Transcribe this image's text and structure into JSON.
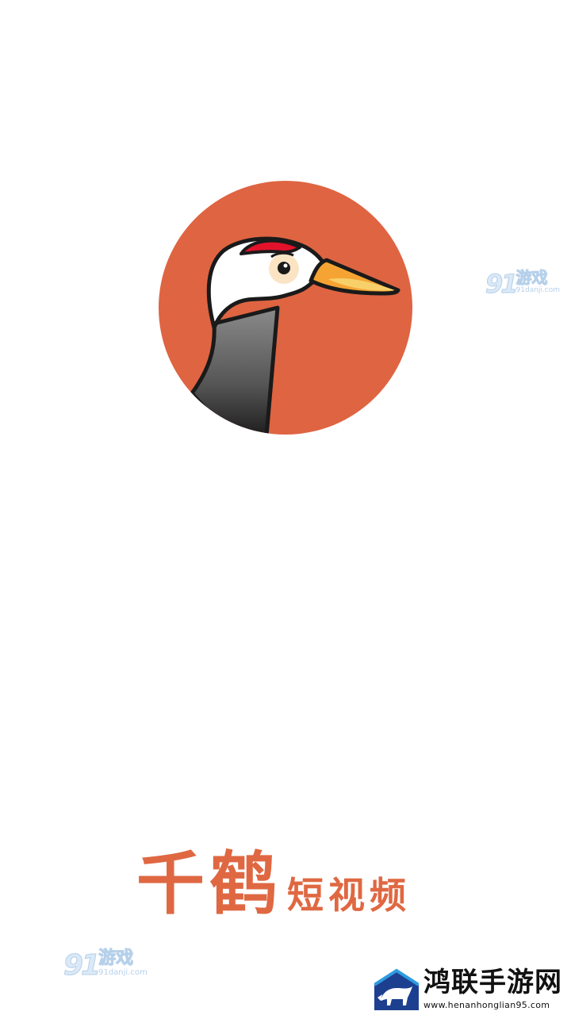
{
  "splash": {
    "logo_icon": "red-crowned-crane-icon",
    "accent_color": "#df6842",
    "title_main": "千鹤",
    "title_sub": "短视频"
  },
  "watermark_top": {
    "number": "91",
    "game": "游戏",
    "url": "91danji.com"
  },
  "watermark_bottom": {
    "number": "91",
    "game": "游戏",
    "url": "91danji.com"
  },
  "brand": {
    "icon": "bull-logo-icon",
    "name": "鸿联手游网",
    "url": "www.henanhonglian95.com"
  }
}
